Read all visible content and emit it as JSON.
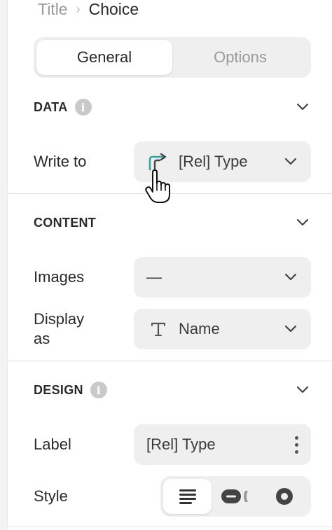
{
  "breadcrumb": {
    "root": "Title",
    "separator": "›",
    "current": "Choice"
  },
  "tabs": [
    {
      "label": "General",
      "active": true
    },
    {
      "label": "Options",
      "active": false
    }
  ],
  "data_section": {
    "title": "DATA",
    "info_icon": "i",
    "write_to": {
      "label": "Write to",
      "value": "[Rel] Type",
      "icon": "relation-arrow-icon"
    }
  },
  "content_section": {
    "title": "CONTENT",
    "images": {
      "label": "Images",
      "value": "—"
    },
    "display_as": {
      "label_line1": "Display",
      "label_line2": "as",
      "value": "Name",
      "icon": "text-T-icon"
    }
  },
  "design_section": {
    "title": "DESIGN",
    "info_icon": "i",
    "label_field": {
      "label": "Label",
      "value": "[Rel] Type"
    },
    "style": {
      "label": "Style",
      "options": [
        "list-style-icon",
        "pill-style-icon",
        "radio-style-icon"
      ],
      "selected": "list-style-icon"
    }
  },
  "colors": {
    "accent_teal": "#2aa7a7",
    "field_bg": "#efefef",
    "text": "#2a2a2a",
    "muted": "#9a9a9a"
  }
}
